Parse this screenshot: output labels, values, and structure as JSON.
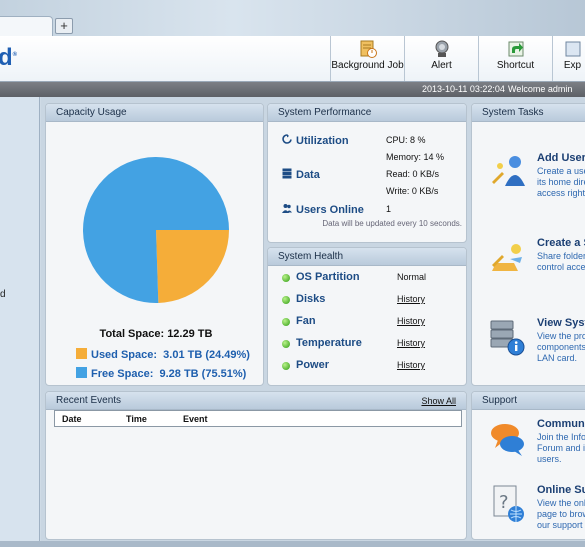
{
  "browser": {
    "new_tab_label": "+"
  },
  "toolbar": {
    "logo_text": "d",
    "buttons": [
      {
        "label": "Background Job",
        "icon": "background-job-icon"
      },
      {
        "label": "Alert",
        "icon": "alert-icon"
      },
      {
        "label": "Shortcut",
        "icon": "shortcut-icon"
      },
      {
        "label": "Exp",
        "icon": "export-icon"
      }
    ]
  },
  "status": {
    "datetime": "2013-10-11 03:22:04",
    "welcome": "Welcome admin"
  },
  "leftnav": {
    "fragment": "d"
  },
  "capacity": {
    "title": "Capacity Usage",
    "total": "Total Space: 12.29 TB",
    "used_label": "Used Space:",
    "used_value": "3.01 TB (24.49%)",
    "free_label": "Free Space:",
    "free_value": "9.28 TB (75.51%)",
    "colors": {
      "used": "#f5ad39",
      "free": "#43a2e3"
    }
  },
  "chart_data": {
    "type": "pie",
    "categories": [
      "Used Space",
      "Free Space"
    ],
    "values": [
      24.49,
      75.51
    ]
  },
  "performance": {
    "title": "System Performance",
    "utilization_label": "Utilization",
    "cpu": "CPU: 8 %",
    "memory": "Memory: 14 %",
    "data_label": "Data",
    "read": "Read: 0 KB/s",
    "write": "Write: 0 KB/s",
    "users_label": "Users Online",
    "users_value": "1",
    "note": "Data will be updated every 10 seconds."
  },
  "health": {
    "title": "System Health",
    "rows": [
      {
        "name": "OS Partition",
        "value": "Normal"
      },
      {
        "name": "Disks",
        "value": "History"
      },
      {
        "name": "Fan",
        "value": "History"
      },
      {
        "name": "Temperature",
        "value": "History"
      },
      {
        "name": "Power",
        "value": "History"
      }
    ]
  },
  "tasks": {
    "title": "System Tasks",
    "items": [
      {
        "title": "Add User",
        "desc": "Create a use its home dire access rights"
      },
      {
        "title": "Create a S",
        "desc": "Share folders control acces"
      },
      {
        "title": "View Syste",
        "desc": "View the prot components LAN card."
      }
    ]
  },
  "events": {
    "title": "Recent Events",
    "show_all": "Show All",
    "columns": [
      "Date",
      "Time",
      "Event"
    ]
  },
  "support": {
    "title": "Support",
    "items": [
      {
        "title": "Communit",
        "desc": "Join the Infor Forum and in users."
      },
      {
        "title": "Online Su",
        "desc": "View the onli page to brow our support t"
      }
    ]
  }
}
